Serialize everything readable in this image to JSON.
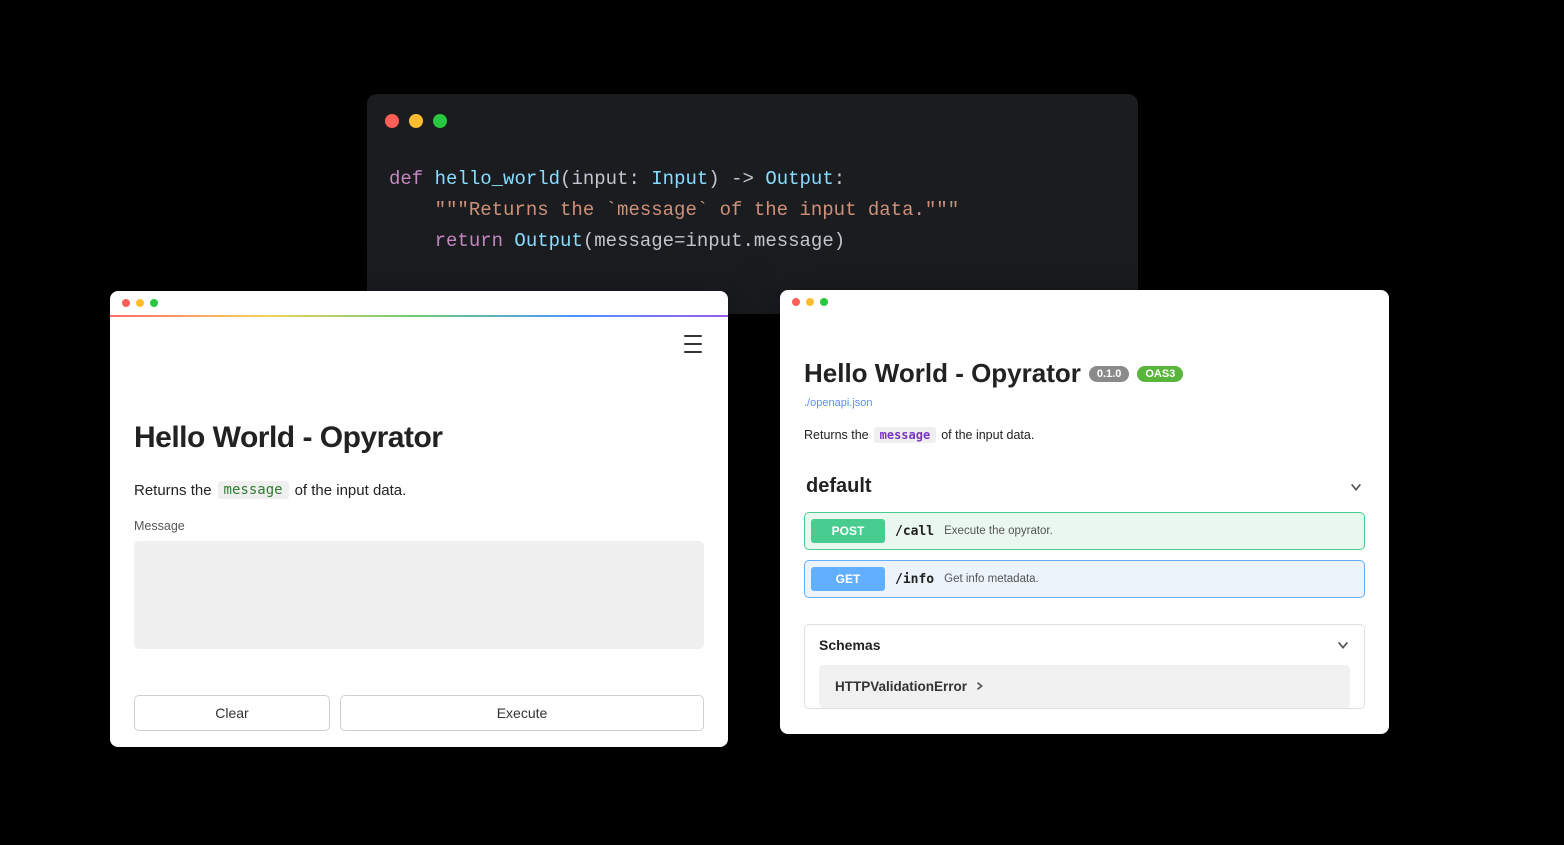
{
  "code": {
    "def": "def",
    "fn": "hello_world",
    "l1_open": "(",
    "l1_param": "input",
    "l1_colon": ": ",
    "l1_ptype": "Input",
    "l1_close_arrow": ") -> ",
    "l1_rtype": "Output",
    "l1_end": ":",
    "l2_doc": "\"\"\"Returns the `message` of the input data.\"\"\"",
    "l3_ret": "return",
    "l3_call": " Output",
    "l3_open": "(",
    "l3_kw": "message",
    "l3_eq": "=",
    "l3_obj": "input",
    "l3_dot": ".",
    "l3_attr": "message",
    "l3_close": ")"
  },
  "ui": {
    "title": "Hello World - Opyrator",
    "desc_pre": "Returns the",
    "desc_code": "message",
    "desc_post": "of the input data.",
    "field_label": "Message",
    "field_value": "",
    "clear_label": "Clear",
    "execute_label": "Execute"
  },
  "api": {
    "title": "Hello World - Opyrator",
    "version": "0.1.0",
    "oas": "OAS3",
    "link": "./openapi.json",
    "desc_pre": "Returns the",
    "desc_code": "message",
    "desc_post": "of the input data.",
    "section": "default",
    "ops": [
      {
        "method": "POST",
        "path": "/call",
        "summary": "Execute the opyrator."
      },
      {
        "method": "GET",
        "path": "/info",
        "summary": "Get info metadata."
      }
    ],
    "schemas_label": "Schemas",
    "schema0": "HTTPValidationError"
  }
}
